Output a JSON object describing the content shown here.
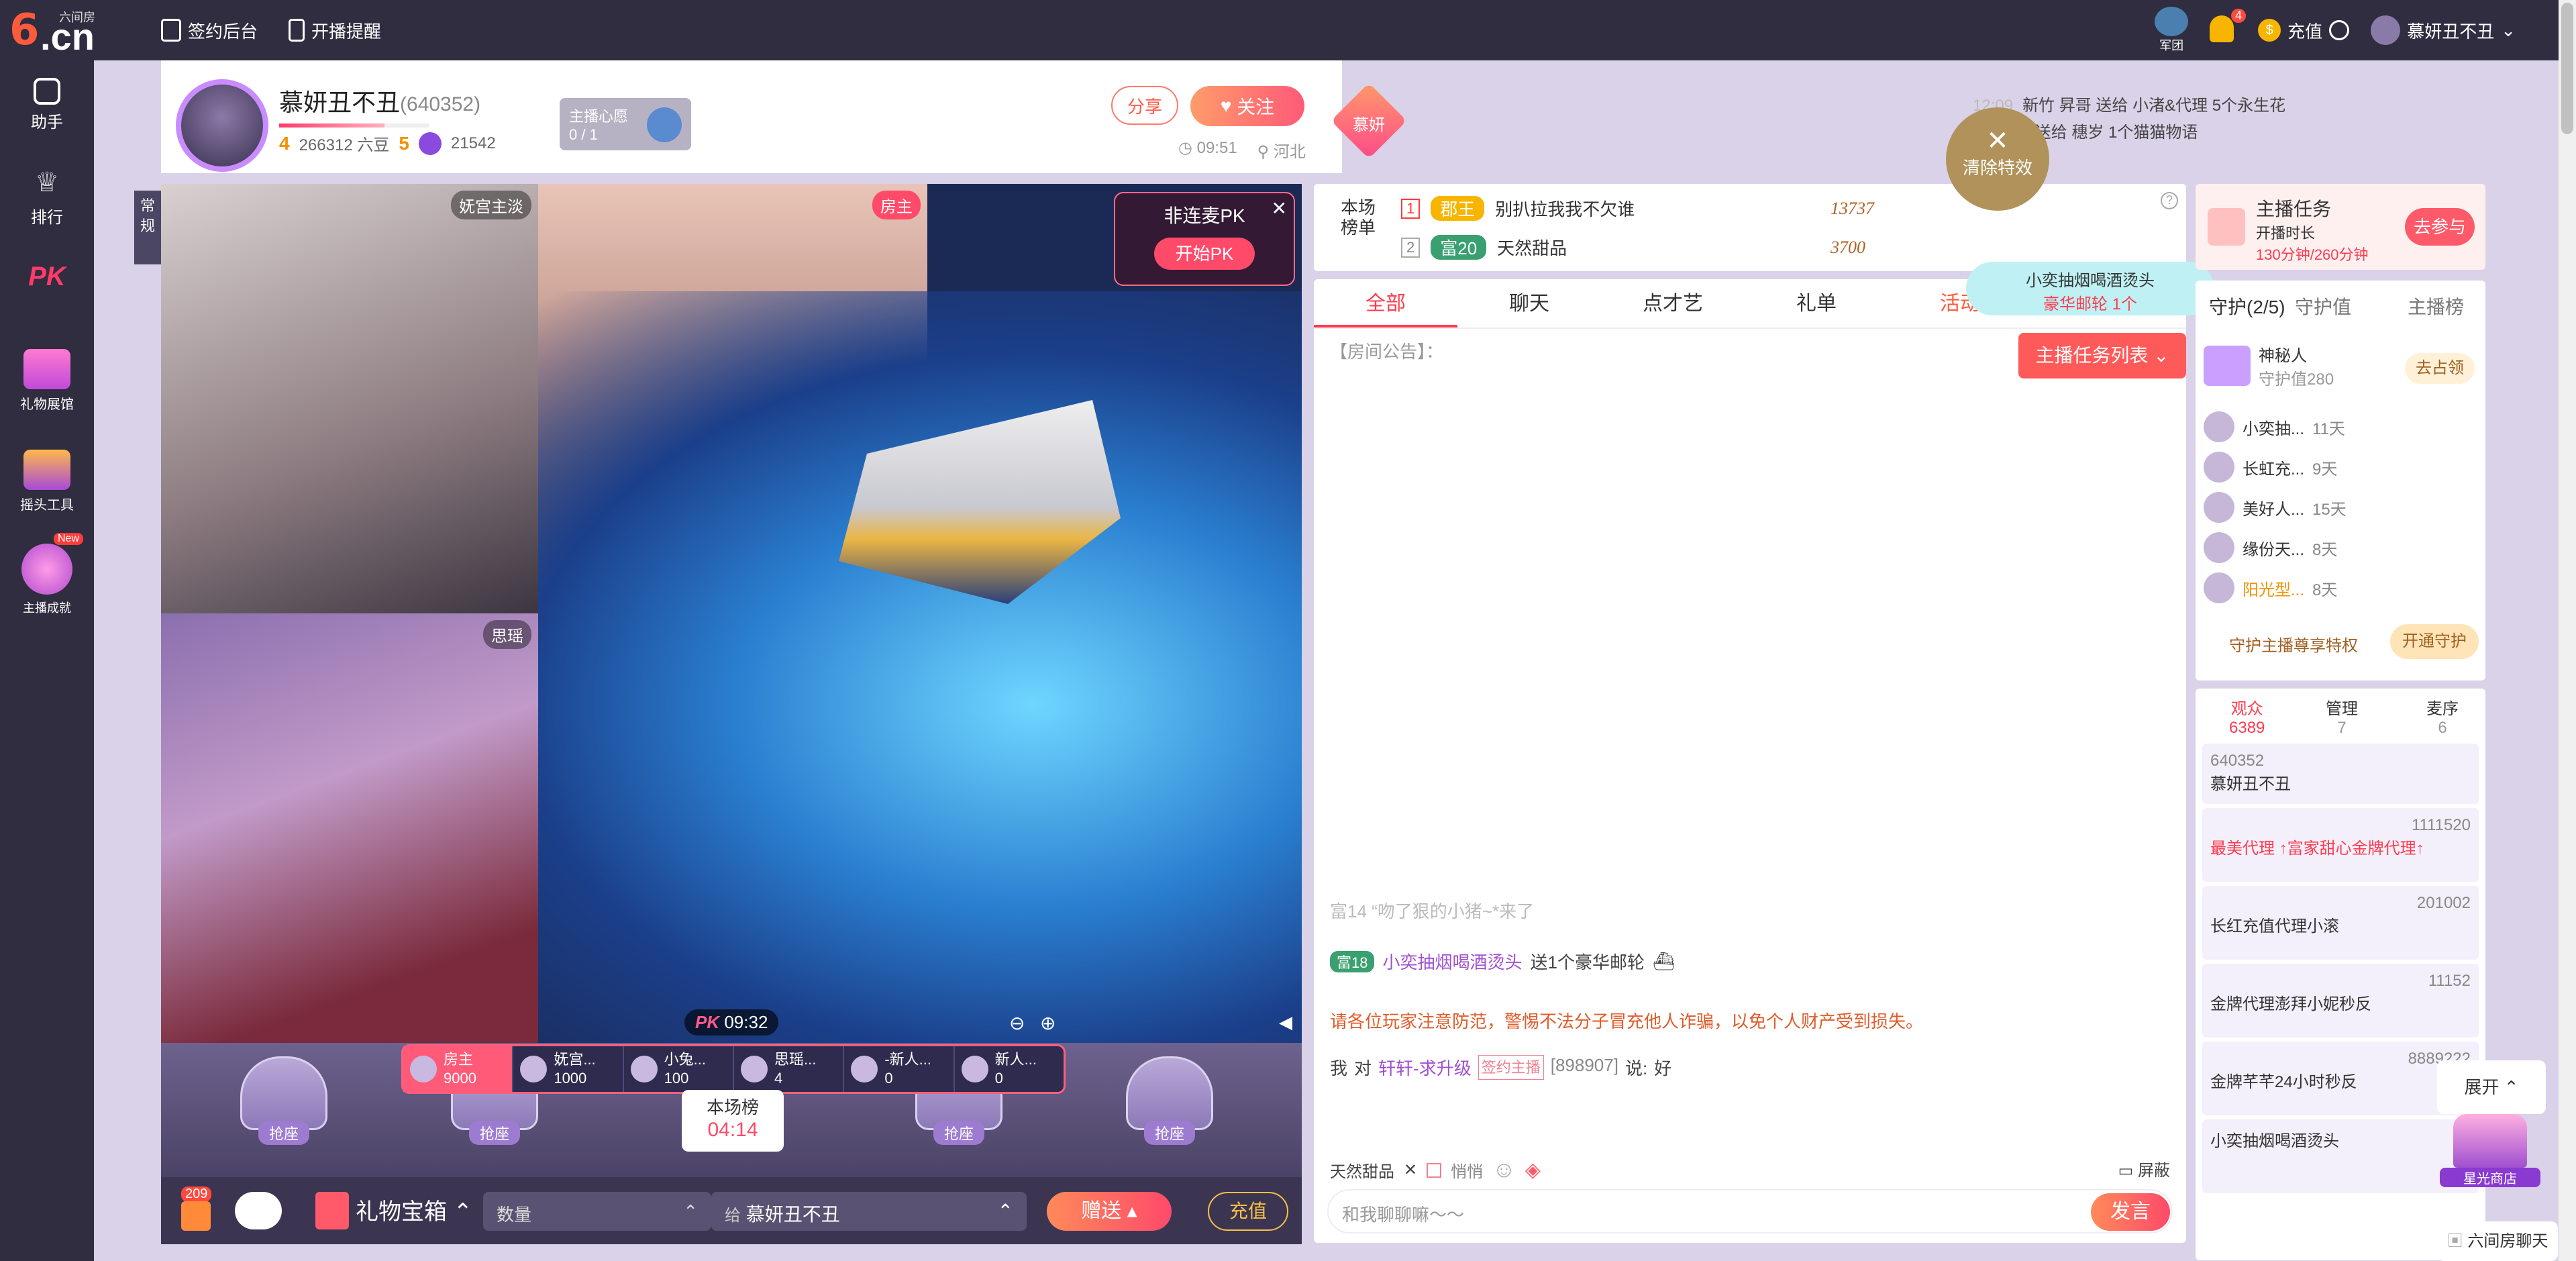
{
  "topbar": {
    "logo": "6.cn",
    "logo_tiny": "六间房",
    "sign_backend": "签约后台",
    "live_remind": "开播提醒",
    "army": "军团",
    "notify_count": "4",
    "recharge": "充值",
    "username": "慕妍丑不丑"
  },
  "sidebar": [
    {
      "label": "助手",
      "icon": "assistant-icon"
    },
    {
      "label": "排行",
      "icon": "crown-icon"
    },
    {
      "label": "PK",
      "icon": "pk-icon"
    },
    {
      "label": "礼物展馆",
      "icon": "gift-hall-icon"
    },
    {
      "label": "摇头工具",
      "icon": "tool-icon"
    },
    {
      "label": "主播成就",
      "icon": "achievement-icon",
      "badge": "New"
    }
  ],
  "anchor": {
    "name": "慕妍丑不丑",
    "id": "(640352)",
    "level": "4",
    "six_beans": "266312 六豆",
    "wealth_level": "5",
    "fans": "21542",
    "wish_title": "主播心愿",
    "wish_progress": "0 / 1",
    "share": "分享",
    "follow": "关注",
    "fan_badge": "慕妍",
    "time": "09:51",
    "location": "河北"
  },
  "ticker": [
    {
      "time": "12:09",
      "text": "新竹 昇哥 送给 小渚&代理 5个永生花"
    },
    {
      "time": "",
      "text": "神秘人 送给 穗岁 1个猫猫物语"
    }
  ],
  "video": {
    "mode": "常规",
    "cam1_label": "妩宫主淡",
    "cam2_label": "房主",
    "cam3_label": "思瑶",
    "nonpk": "非连麦PK",
    "start_pk": "开始PK",
    "pk_timer": "09:32"
  },
  "seats": [
    {
      "grab": "抢座"
    },
    {
      "grab": "抢座"
    },
    {
      "grab": "抢座"
    },
    {
      "grab": "抢座"
    }
  ],
  "rank_strip": [
    {
      "name": "房主",
      "value": "9000"
    },
    {
      "name": "妩宫...",
      "value": "1000"
    },
    {
      "name": "小兔...",
      "value": "100"
    },
    {
      "name": "思瑶...",
      "value": "4"
    },
    {
      "name": "-新人...",
      "value": "0"
    },
    {
      "name": "新人...",
      "value": "0"
    }
  ],
  "hall": {
    "title": "本场榜",
    "time": "04:14"
  },
  "giftbar": {
    "count": "209",
    "box": "礼物宝箱",
    "qty": "数量",
    "to": "给",
    "receiver": "慕妍丑不丑",
    "send": "赠送",
    "recharge": "充值"
  },
  "billboard": {
    "title": "本场榜单",
    "rows": [
      {
        "rank": "1",
        "badge": "郡王",
        "name": "别扒拉我我不欠谁",
        "score": "13737"
      },
      {
        "rank": "2",
        "badge": "富20",
        "name": "天然甜品",
        "score": "3700"
      }
    ]
  },
  "chat": {
    "tabs": [
      "全部",
      "聊天",
      "点才艺",
      "礼单",
      "活动"
    ],
    "announce": "【房间公告】：",
    "task_list": "主播任务列表",
    "faded_msg": "富14 “吻了狠的小猪~*来了",
    "gift_msg_user": "小奕抽烟喝酒烫头",
    "gift_msg_action": "送1个豪华邮轮",
    "warning": "请各位玩家注意防范，警惕不法分子冒充他人诈骗，以免个人财产受到损失。",
    "reply_from": "我",
    "reply_to": "轩轩-求升级",
    "reply_tag": "签约主播",
    "reply_id": "[898907]",
    "reply_said": "说:",
    "reply_text": "好",
    "input_user": "天然甜品",
    "whisper": "悄悄",
    "shield": "屏蔽",
    "placeholder": "和我聊聊嘛～～",
    "send": "发言"
  },
  "effects": {
    "clear": "清除特效",
    "bubble_user": "小奕抽烟喝酒烫头",
    "bubble_text": "豪华邮轮 1个"
  },
  "task": {
    "title": "主播任务",
    "line1": "开播时长",
    "line2": "130分钟/260分钟",
    "join": "去参与"
  },
  "guard": {
    "tabs": [
      "守护(2/5)",
      "守护值",
      "主播榜"
    ],
    "top_name": "神秘人",
    "top_value": "守护值280",
    "occupy": "去占领",
    "rows": [
      {
        "name": "小奕抽...",
        "days": "11天"
      },
      {
        "name": "长虹充...",
        "days": "9天"
      },
      {
        "name": "美好人...",
        "days": "15天"
      },
      {
        "name": "缘份天...",
        "days": "8天"
      },
      {
        "name": "阳光型...",
        "days": "8天"
      }
    ],
    "privilege": "守护主播尊享特权",
    "open": "开通守护"
  },
  "audience": {
    "tabs": [
      {
        "label": "观众",
        "count": "6389"
      },
      {
        "label": "管理",
        "count": "7"
      },
      {
        "label": "麦序",
        "count": "6"
      }
    ],
    "items": [
      {
        "id": "640352",
        "name": "慕妍丑不丑"
      },
      {
        "id": "1111520",
        "name": "最美代理 ↑富家甜心金牌代理↑"
      },
      {
        "id": "201002",
        "name": "长红充值代理小滚"
      },
      {
        "id": "11152",
        "name": "金牌代理澎拜小妮秒反"
      },
      {
        "id": "8889222",
        "name": "金牌芊芊24小时秒反"
      },
      {
        "id": "",
        "name": "小奕抽烟喝酒烫头"
      }
    ]
  },
  "float": {
    "expand": "展开",
    "store": "星光商店",
    "chat": "六间房聊天"
  }
}
